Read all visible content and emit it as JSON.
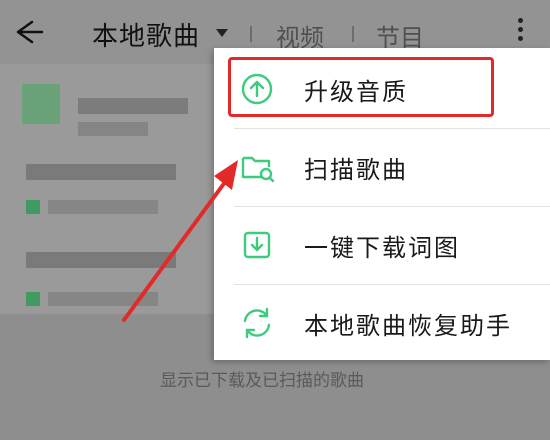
{
  "header": {
    "title": "本地歌曲",
    "tabs": [
      "视频",
      "节目"
    ]
  },
  "menu": {
    "items": [
      {
        "label": "升级音质",
        "icon": "upgrade-icon"
      },
      {
        "label": "扫描歌曲",
        "icon": "folder-scan-icon"
      },
      {
        "label": "一键下载词图",
        "icon": "download-icon"
      },
      {
        "label": "本地歌曲恢复助手",
        "icon": "restore-icon"
      }
    ]
  },
  "list": {
    "empty_hint": "显示已下载及已扫描的歌曲"
  },
  "colors": {
    "accent": "#3ecb7e",
    "highlight": "#e22a2a"
  }
}
